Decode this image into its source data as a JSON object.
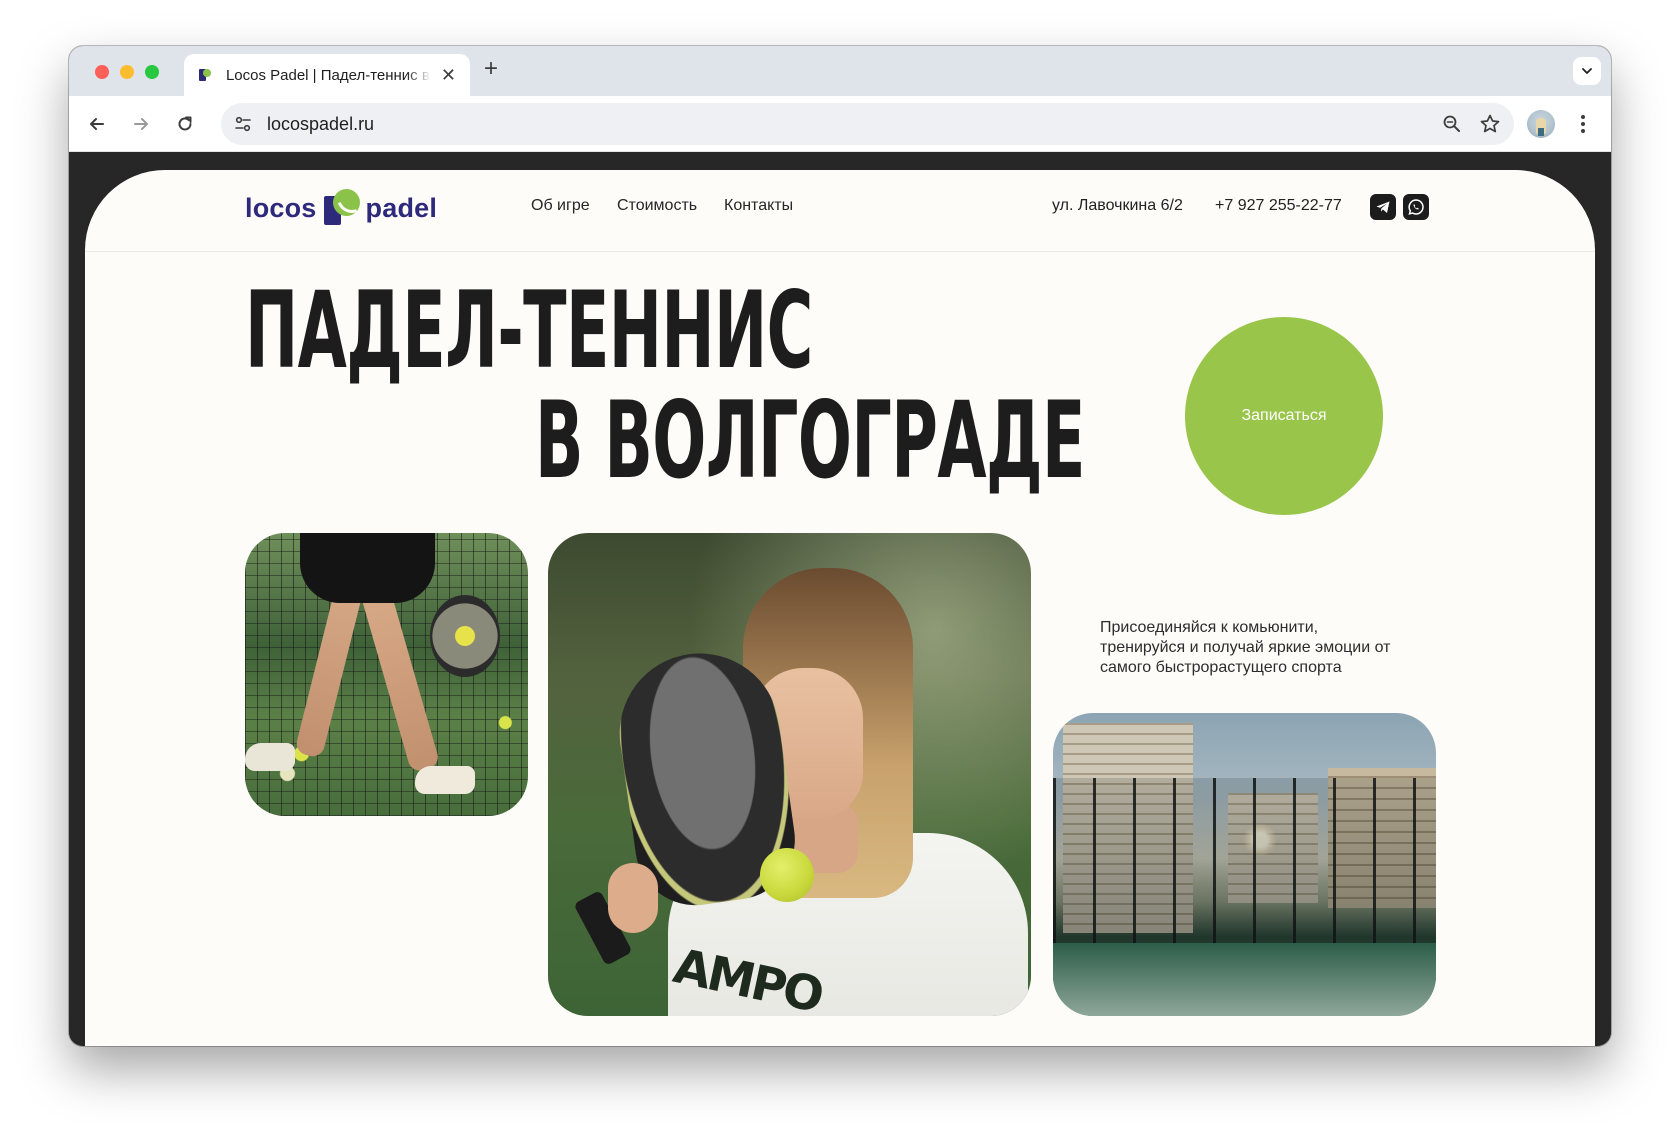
{
  "browser": {
    "tab_title": "Locos Padel | Падел-теннис в Волгограде",
    "url": "locospadel.ru",
    "new_tab_label": "+",
    "close_tab_label": "✕"
  },
  "site": {
    "logo": {
      "left": "locos",
      "right": "padel"
    },
    "nav": [
      {
        "label": "Об игре"
      },
      {
        "label": "Стоимость"
      },
      {
        "label": "Контакты"
      }
    ],
    "address": "ул. Лавочкина 6/2",
    "phone": "+7 927 255-22-77",
    "social": [
      {
        "icon": "telegram-icon"
      },
      {
        "icon": "whatsapp-icon"
      }
    ]
  },
  "hero": {
    "title_line1": "ПАДЕЛ-ТЕННИС",
    "title_line2": "В ВОЛГОГРАДЕ",
    "cta_label": "Записаться",
    "tagline": "Присоединяйся к комьюнити, тренируйся и получай яркие эмоции от самого быстрорастущего спорта",
    "photo_text": "AMPO"
  },
  "colors": {
    "brand_navy": "#2e2a7b",
    "brand_green": "#9ac54b",
    "page_bg": "#fdfcf8",
    "text_dark": "#1d1d1d"
  }
}
